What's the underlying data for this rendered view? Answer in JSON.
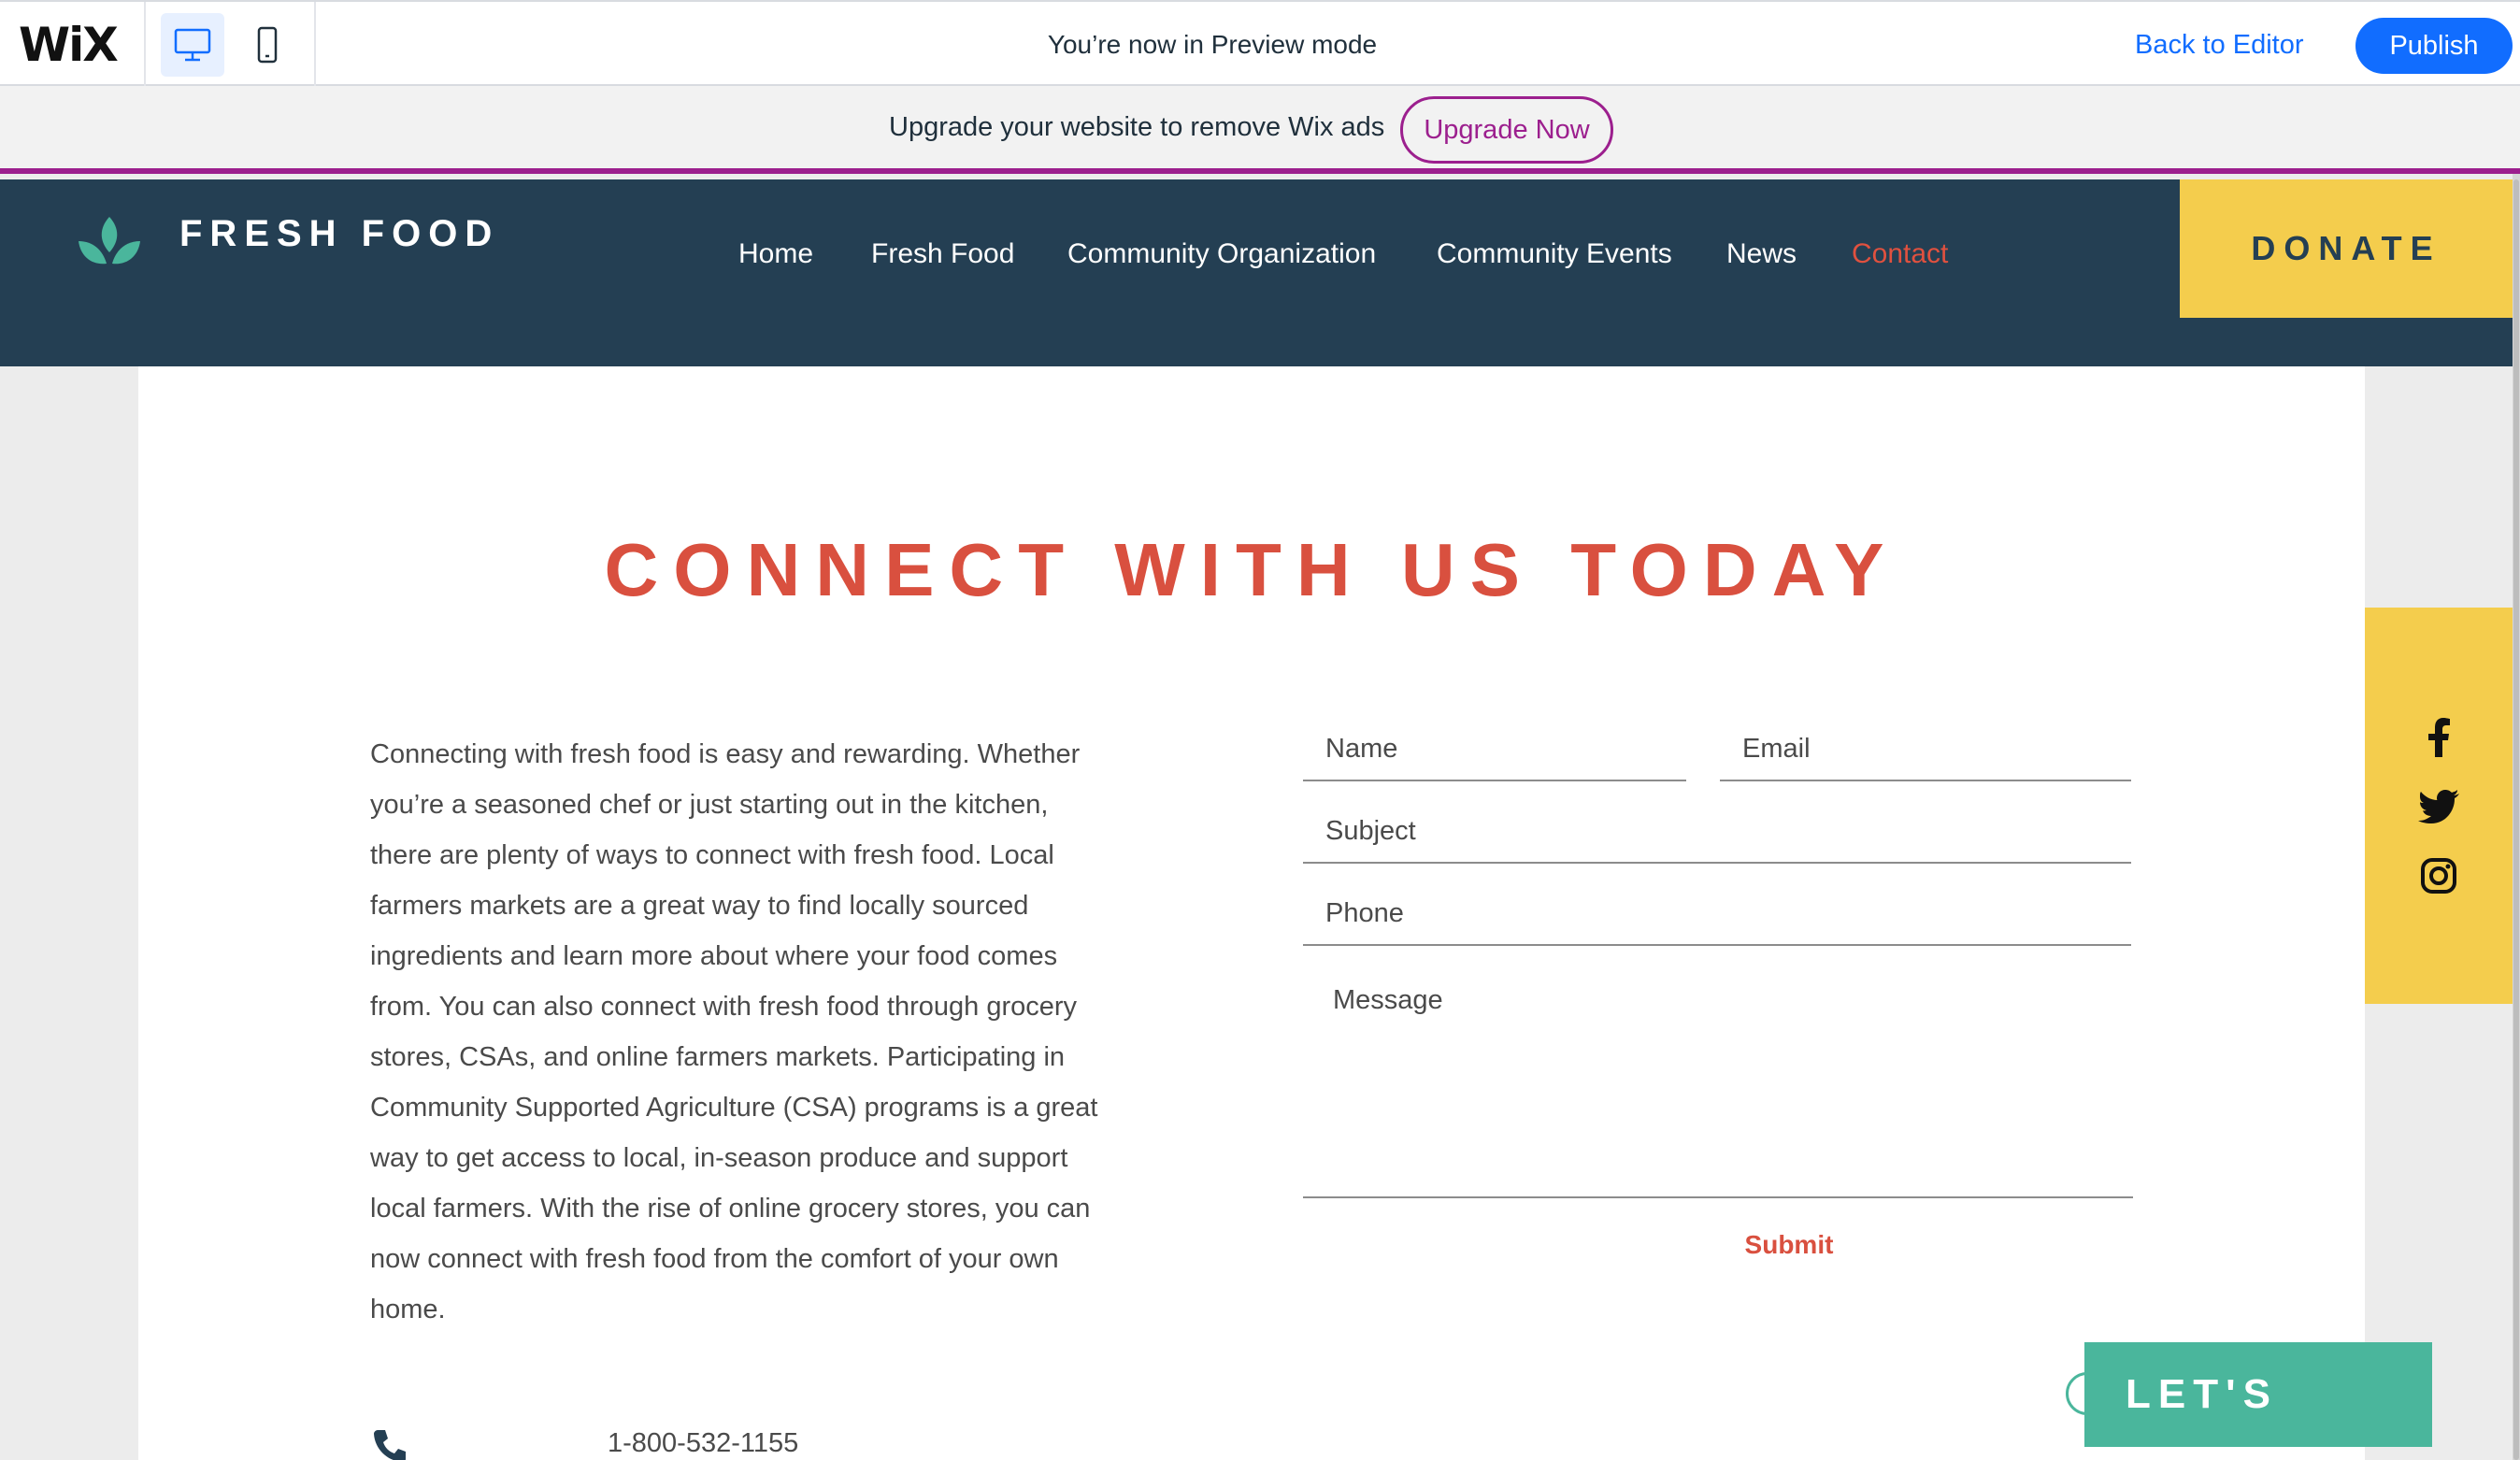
{
  "wix_toolbar": {
    "logo": "WiX",
    "preview_message": "You’re now in Preview mode",
    "back_to_editor": "Back to Editor",
    "publish": "Publish",
    "devices": [
      "desktop-icon",
      "mobile-icon"
    ]
  },
  "ad_bar": {
    "message": "Upgrade your website to remove Wix ads",
    "upgrade_button": "Upgrade Now",
    "accent_color": "#9c1f8e"
  },
  "header": {
    "brand": "FRESH FOOD",
    "nav": [
      {
        "label": "Home"
      },
      {
        "label": "Fresh Food"
      },
      {
        "label": "Community Organization"
      },
      {
        "label": "Community Events"
      },
      {
        "label": "News"
      },
      {
        "label": "Contact",
        "current": true
      }
    ],
    "donate": "DONATE",
    "background_color": "#243f53",
    "donate_color": "#f4cd4d"
  },
  "main": {
    "title": "CONNECT WITH US TODAY",
    "title_color": "#d9503f",
    "intro": "Connecting with fresh food is easy and rewarding. Whether you’re a seasoned chef or just starting out in the kitchen, there are plenty of ways to connect with fresh food. Local farmers markets are a great way to find locally sourced ingredients and learn more about where your food comes from. You can also connect with fresh food through grocery stores, CSAs, and online farmers markets. Participating in Community Supported Agriculture (CSA) programs is a great way to get access to local, in-season produce and support local farmers. With the rise of online grocery stores, you can now connect with fresh food from the comfort of your own home.",
    "phone": "1-800-532-1155"
  },
  "form": {
    "name_placeholder": "Name",
    "email_placeholder": "Email",
    "subject_placeholder": "Subject",
    "phone_placeholder": "Phone",
    "message_placeholder": "Message",
    "submit": "Submit"
  },
  "social": [
    "facebook-icon",
    "twitter-icon",
    "instagram-icon"
  ],
  "chat": {
    "label": "LET'S CHAT!",
    "color": "#4ab69c"
  }
}
